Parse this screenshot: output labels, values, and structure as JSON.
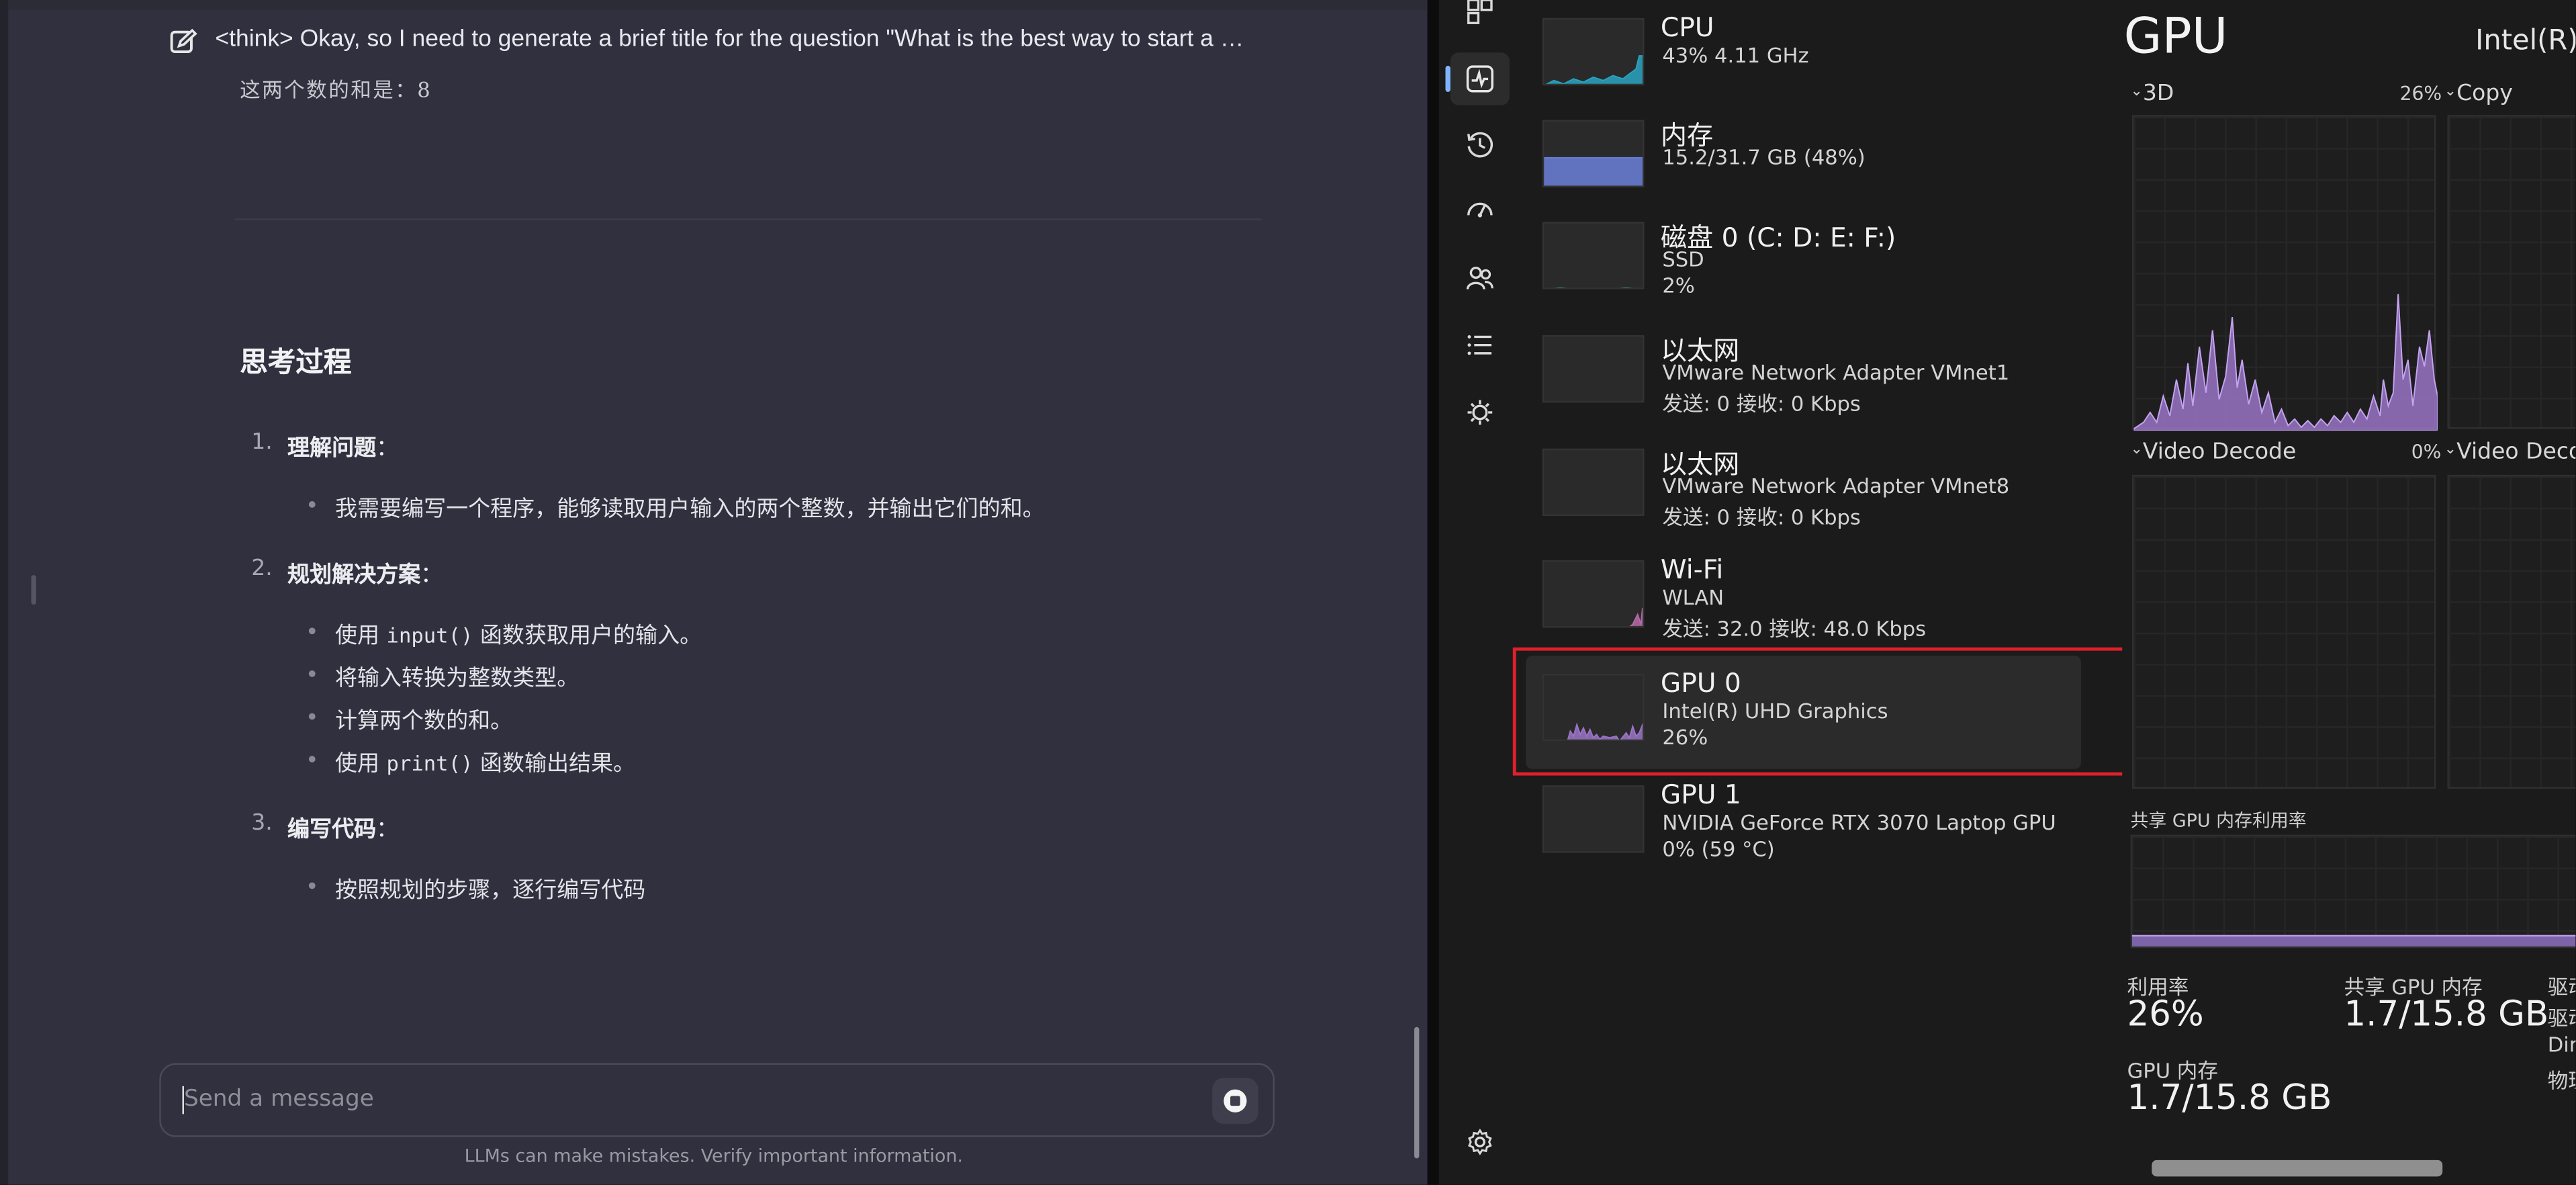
{
  "chat": {
    "thread_title": "<think> Okay, so I need to generate a brief title for the question \"What is the best way to start a …",
    "partial_text": "这两个数的和是：8",
    "section_heading": "思考过程",
    "steps": [
      {
        "num": "1.",
        "title": "理解问题",
        "colon": "：",
        "bullets": [
          [
            "我需要编写一个程序，能够读取用户输入的两个整数，并输出它们的和。"
          ]
        ]
      },
      {
        "num": "2.",
        "title": "规划解决方案",
        "colon": "：",
        "bullets": [
          [
            "使用 ",
            "input()",
            " 函数获取用户的输入。"
          ],
          [
            "将输入转换为整数类型。"
          ],
          [
            "计算两个数的和。"
          ],
          [
            "使用 ",
            "print()",
            " 函数输出结果。"
          ]
        ]
      },
      {
        "num": "3.",
        "title": "编写代码",
        "colon": "：",
        "bullets": [
          [
            "按照规划的步骤，逐行编写代码"
          ]
        ]
      }
    ],
    "input_placeholder": "Send a message",
    "disclaimer": "LLMs can make mistakes. Verify important information."
  },
  "task_manager": {
    "nav_icons": [
      "apps-icon",
      "performance-icon",
      "app-history-icon",
      "startup-apps-icon",
      "users-icon",
      "details-icon",
      "services-icon",
      "settings-icon"
    ],
    "devices": [
      {
        "name": "CPU",
        "line1": "43% 4.11 GHz",
        "line2": "",
        "line3": "",
        "color": "#29a3bf"
      },
      {
        "name": "内存",
        "line1": "15.2/31.7 GB (48%)",
        "line2": "",
        "line3": "",
        "color": "#6b7fd8"
      },
      {
        "name": "磁盘 0 (C: D: E: F:)",
        "line1": "SSD",
        "line2": "2%",
        "line3": "",
        "color": "#3a9a6a"
      },
      {
        "name": "以太网",
        "line1": "VMware Network Adapter VMnet1",
        "line2": "发送: 0 接收: 0 Kbps",
        "line3": "",
        "color": "#a0a0a0"
      },
      {
        "name": "以太网",
        "line1": "VMware Network Adapter VMnet8",
        "line2": "发送: 0 接收: 0 Kbps",
        "line3": "",
        "color": "#a0a0a0"
      },
      {
        "name": "Wi-Fi",
        "line1": "WLAN",
        "line2": "发送: 32.0 接收: 48.0 Kbps",
        "line3": "",
        "color": "#b56aa8"
      },
      {
        "name": "GPU 0",
        "line1": "Intel(R) UHD Graphics",
        "line2": "26%",
        "line3": "",
        "color": "#9a74c6"
      },
      {
        "name": "GPU 1",
        "line1": "NVIDIA GeForce RTX 3070 Laptop GPU",
        "line2": "0% (59 °C)",
        "line3": "",
        "color": "#9a74c6"
      }
    ],
    "gpu": {
      "title": "GPU",
      "model": "Intel(R)",
      "engines": [
        {
          "label": "3D",
          "pct": "26%"
        },
        {
          "label": "Copy",
          "pct": ""
        },
        {
          "label": "Video Decode",
          "pct": "0%"
        },
        {
          "label": "Video Deco",
          "pct": ""
        }
      ],
      "shared_mem_label": "共享 GPU 内存利用率",
      "stats": {
        "util_label": "利用率",
        "util_value": "26%",
        "shared_label": "共享 GPU 内存",
        "shared_value": "1.7/15.8 GB",
        "gpu_mem_label": "GPU 内存",
        "gpu_mem_value": "1.7/15.8 GB",
        "right_labels": [
          "驱动",
          "驱动",
          "Dir",
          "物理"
        ]
      },
      "fill_color": "#9a74c6"
    }
  }
}
